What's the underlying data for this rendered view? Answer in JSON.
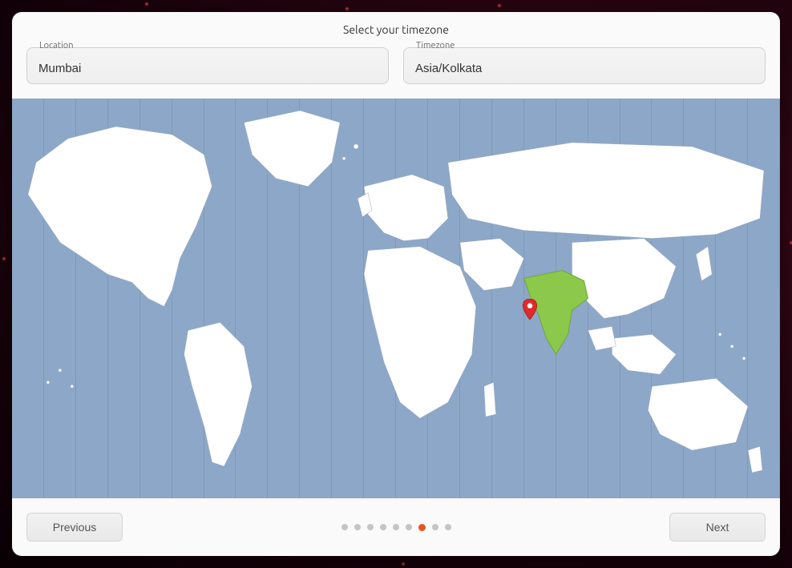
{
  "dialog": {
    "title": "Select your timezone"
  },
  "fields": {
    "location": {
      "label": "Location",
      "value": "Mumbai"
    },
    "timezone": {
      "label": "Timezone",
      "value": "Asia/Kolkata"
    }
  },
  "map": {
    "highlighted_region": "India",
    "pin_location": "Mumbai",
    "highlight_color": "#8cc84a",
    "pin_color": "#e12a2a"
  },
  "footer": {
    "previous_label": "Previous",
    "next_label": "Next"
  },
  "progress": {
    "total_steps": 9,
    "current_step": 7
  }
}
